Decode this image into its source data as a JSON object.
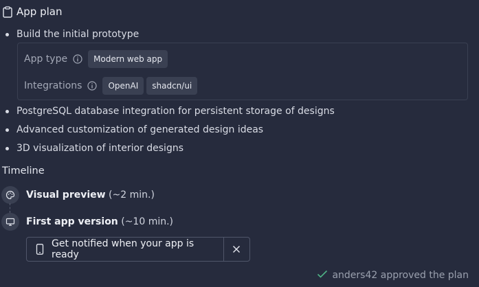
{
  "header": {
    "title": "App plan",
    "icon": "clipboard-icon"
  },
  "plan_items": [
    "Build the initial prototype",
    "PostgreSQL database integration for persistent storage of designs",
    "Advanced customization of generated design ideas",
    "3D visualization of interior designs"
  ],
  "details": {
    "app_type_label": "App type",
    "app_type_value": "Modern web app",
    "integrations_label": "Integrations",
    "integrations": [
      "OpenAI",
      "shadcn/ui"
    ]
  },
  "timeline": {
    "title": "Timeline",
    "steps": [
      {
        "name": "Visual preview",
        "duration": "(~2 min.)",
        "icon": "palette-icon"
      },
      {
        "name": "First app version",
        "duration": "(~10 min.)",
        "icon": "monitor-icon"
      }
    ]
  },
  "notify": {
    "label": "Get notified when your app is ready",
    "icon": "phone-icon"
  },
  "approval": {
    "text": "anders42 approved the plan",
    "icon": "check-icon"
  },
  "colors": {
    "background": "#262b3d",
    "chip": "#3a4052",
    "check": "#4fb386"
  }
}
